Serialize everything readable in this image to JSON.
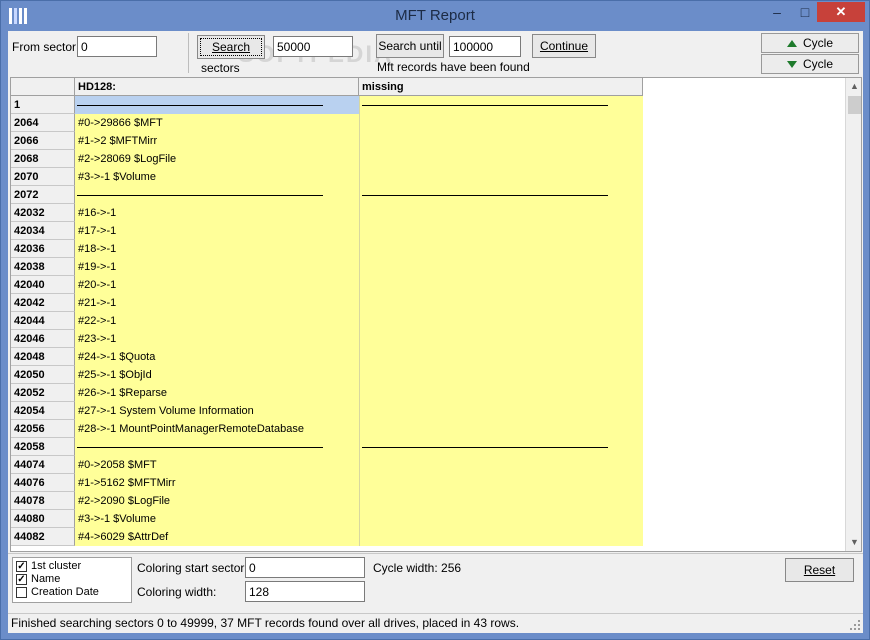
{
  "window": {
    "title": "MFT Report",
    "min_glyph": "–",
    "max_glyph": "□",
    "close_glyph": "✕"
  },
  "watermark": "SOFTPEDIA",
  "toolbar": {
    "from_sector_label": "From sector:",
    "from_sector_value": "0",
    "search_label": "Search",
    "sectors_label": "sectors",
    "sectors_value": "50000",
    "search_until_label": "Search until",
    "search_until_value": "100000",
    "mft_found_label": "Mft records have been found",
    "continue_label": "Continue",
    "cycle_up_label": "Cycle",
    "cycle_down_label": "Cycle"
  },
  "grid": {
    "columns": [
      "HD128:",
      "missing"
    ],
    "rows": [
      {
        "num": "1",
        "c1": "",
        "c2": "",
        "line1": true,
        "line2": true,
        "sel": true
      },
      {
        "num": "2064",
        "c1": "#0->29866 $MFT",
        "c2": ""
      },
      {
        "num": "2066",
        "c1": "#1->2 $MFTMirr",
        "c2": ""
      },
      {
        "num": "2068",
        "c1": "#2->28069 $LogFile",
        "c2": ""
      },
      {
        "num": "2070",
        "c1": "#3->-1 $Volume",
        "c2": ""
      },
      {
        "num": "2072",
        "c1": "",
        "c2": "",
        "line1": true,
        "line2": true
      },
      {
        "num": "42032",
        "c1": "#16->-1",
        "c2": ""
      },
      {
        "num": "42034",
        "c1": "#17->-1",
        "c2": ""
      },
      {
        "num": "42036",
        "c1": "#18->-1",
        "c2": ""
      },
      {
        "num": "42038",
        "c1": "#19->-1",
        "c2": ""
      },
      {
        "num": "42040",
        "c1": "#20->-1",
        "c2": ""
      },
      {
        "num": "42042",
        "c1": "#21->-1",
        "c2": ""
      },
      {
        "num": "42044",
        "c1": "#22->-1",
        "c2": ""
      },
      {
        "num": "42046",
        "c1": "#23->-1",
        "c2": ""
      },
      {
        "num": "42048",
        "c1": "#24->-1 $Quota",
        "c2": ""
      },
      {
        "num": "42050",
        "c1": "#25->-1 $ObjId",
        "c2": ""
      },
      {
        "num": "42052",
        "c1": "#26->-1 $Reparse",
        "c2": ""
      },
      {
        "num": "42054",
        "c1": "#27->-1 System Volume Information",
        "c2": ""
      },
      {
        "num": "42056",
        "c1": "#28->-1 MountPointManagerRemoteDatabase",
        "c2": ""
      },
      {
        "num": "42058",
        "c1": "",
        "c2": "",
        "line1": true,
        "line2": true
      },
      {
        "num": "44074",
        "c1": "#0->2058 $MFT",
        "c2": ""
      },
      {
        "num": "44076",
        "c1": "#1->5162 $MFTMirr",
        "c2": ""
      },
      {
        "num": "44078",
        "c1": "#2->2090 $LogFile",
        "c2": ""
      },
      {
        "num": "44080",
        "c1": "#3->-1 $Volume",
        "c2": ""
      },
      {
        "num": "44082",
        "c1": "#4->6029 $AttrDef",
        "c2": ""
      }
    ]
  },
  "options": {
    "items": [
      {
        "label": "1st cluster",
        "checked": true
      },
      {
        "label": "Name",
        "checked": true
      },
      {
        "label": "Creation Date",
        "checked": false
      }
    ],
    "coloring_start_label": "Coloring start sector:",
    "coloring_start_value": "0",
    "coloring_width_label": "Coloring width:",
    "coloring_width_value": "128",
    "cycle_width_text": "Cycle width: 256",
    "reset_label": "Reset"
  },
  "status": {
    "text": "Finished searching sectors 0 to 49999, 37 MFT records found over all drives, placed in 43 rows."
  }
}
